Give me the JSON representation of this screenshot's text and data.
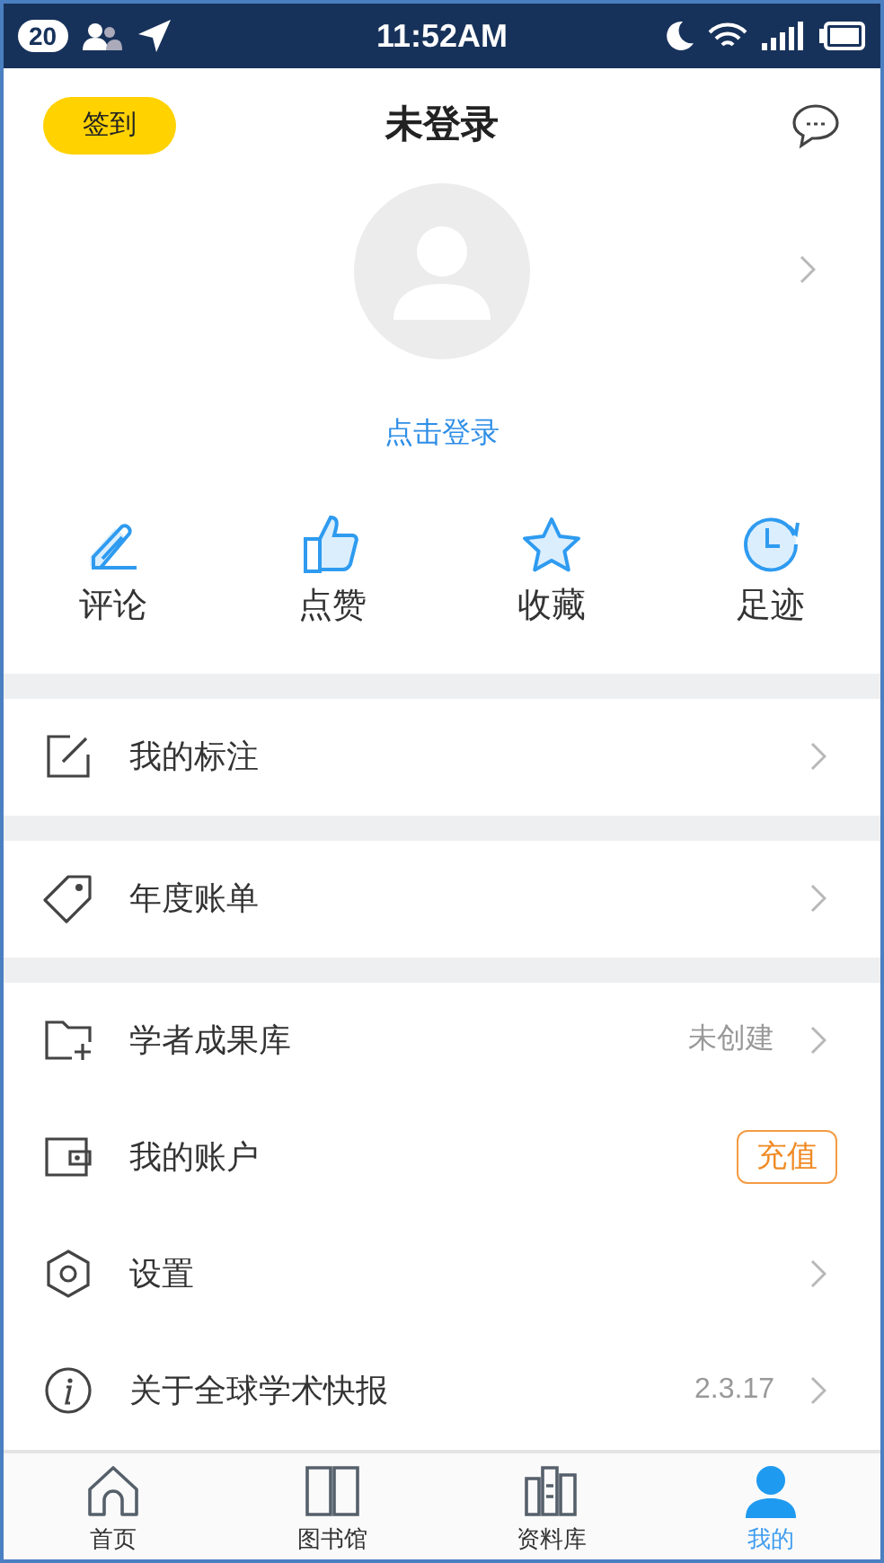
{
  "status_bar": {
    "notification_count": "20",
    "time": "11:52AM"
  },
  "header": {
    "checkin_button": "签到",
    "title": "未登录"
  },
  "profile": {
    "login_link": "点击登录"
  },
  "shortcuts": [
    {
      "label": "评论"
    },
    {
      "label": "点赞"
    },
    {
      "label": "收藏"
    },
    {
      "label": "足迹"
    }
  ],
  "menu_groups": [
    [
      {
        "label": "我的标注",
        "kind": "plain"
      }
    ],
    [
      {
        "label": "年度账单",
        "kind": "plain"
      }
    ],
    [
      {
        "label": "学者成果库",
        "kind": "value",
        "value": "未创建"
      },
      {
        "label": "我的账户",
        "kind": "badge",
        "value": "充值"
      },
      {
        "label": "设置",
        "kind": "plain"
      },
      {
        "label": "关于全球学术快报",
        "kind": "value",
        "value": "2.3.17"
      }
    ]
  ],
  "tab_bar": [
    {
      "label": "首页",
      "selected": false
    },
    {
      "label": "图书馆",
      "selected": false
    },
    {
      "label": "资料库",
      "selected": false
    },
    {
      "label": "我的",
      "selected": true
    }
  ]
}
